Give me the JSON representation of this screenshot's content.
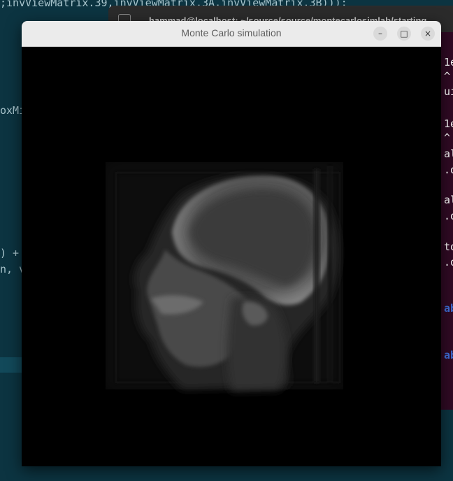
{
  "editor": {
    "lines": [
      ";invViewMatrix.39,invViewMatrix.3A,invViewMatrix.3B)));",
      "oxMi",
      ") +",
      "n, v"
    ]
  },
  "terminal": {
    "title": "hammad@localhost: ~/source/source/montecarlosimlab/starting",
    "lines": [
      {
        "text": "1e",
        "style": "white"
      },
      {
        "text": "^",
        "style": "white"
      },
      {
        "text": "uin",
        "style": "white"
      },
      {
        "text": "1e",
        "style": "white"
      },
      {
        "text": "^",
        "style": "white"
      },
      {
        "text": "alp",
        "style": "white"
      },
      {
        "text": ".or",
        "style": "white"
      },
      {
        "text": "alp",
        "style": "white"
      },
      {
        "text": ".or",
        "style": "white"
      },
      {
        "text": "to",
        "style": "white"
      },
      {
        "text": ".or",
        "style": "white"
      },
      {
        "text": "ab",
        "style": "blue"
      },
      {
        "text": "ab",
        "style": "blue"
      }
    ]
  },
  "window": {
    "title": "Monte Carlo simulation",
    "minimize_glyph": "–",
    "maximize_glyph": "□",
    "close_glyph": "×"
  },
  "viewport": {
    "content": "x-ray-skull-rendering",
    "colors": {
      "background": "#000000",
      "bone": "#9c9c9c",
      "tissue": "#2a2a2a"
    }
  }
}
